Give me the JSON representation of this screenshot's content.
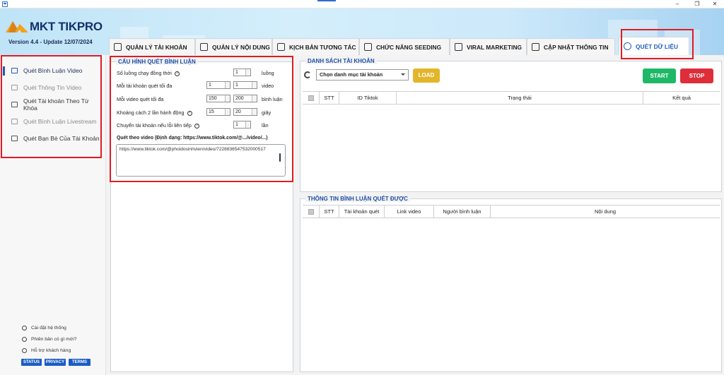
{
  "app": {
    "name": "MKT TIKPRO",
    "version": "Version  4.4  - Update  12/07/2024"
  },
  "window": {
    "minimize": "–",
    "restore": "❐",
    "close": "✕"
  },
  "tabs": [
    {
      "label": "QUẢN LÝ TÀI KHOẢN",
      "icon": "account-icon"
    },
    {
      "label": "QUẢN LÝ NỘI DUNG",
      "icon": "list-icon"
    },
    {
      "label": "KỊCH BẢN TƯƠNG TÁC",
      "icon": "hand-icon"
    },
    {
      "label": "CHỨC NĂNG SEEDING",
      "icon": "seeding-icon"
    },
    {
      "label": "VIRAL MARKETING",
      "icon": "viral-icon"
    },
    {
      "label": "CẬP NHẬT THÔNG TIN",
      "icon": "update-icon"
    },
    {
      "label": "QUÉT DỮ LIỆU",
      "icon": "scan-icon",
      "active": true
    }
  ],
  "sidebar": {
    "items": [
      {
        "label": "Quét Bình Luận Video",
        "icon": "comment-icon",
        "state": "active"
      },
      {
        "label": "Quét Thông Tin Video",
        "icon": "video-icon",
        "state": "muted"
      },
      {
        "label": "Quét Tài khoản Theo Từ Khóa",
        "icon": "keyword-icon",
        "state": "normal"
      },
      {
        "label": "Quét Bình Luận Livestream",
        "icon": "livestream-icon",
        "state": "muted"
      },
      {
        "label": "Quét Bạn Bè Của Tài Khoản",
        "icon": "friends-icon",
        "state": "normal"
      }
    ],
    "footer": {
      "settings": "Cài đặt hệ thống",
      "whats_new": "Phiên bản có gì mới?",
      "support": "Hỗ trợ khách hàng",
      "buttons": [
        "STATUS",
        "PRIVACY",
        "TERMS"
      ]
    }
  },
  "config": {
    "title": "CẤU HÌNH QUÉT BÌNH LUẬN",
    "threads_label": "Số luồng chạy đồng thời",
    "threads_value": "1",
    "threads_unit": "luồng",
    "max_accounts_label": "Mỗi tài khoản quét tối đa",
    "max_accounts_from": "1",
    "max_accounts_to": "1",
    "max_accounts_unit": "video",
    "max_comments_label": "Mỗi video quét tối đa",
    "max_comments_from": "150",
    "max_comments_to": "200",
    "max_comments_unit": "bình luận",
    "delay_label": "Khoảng cách 2 lần hành động",
    "delay_from": "15",
    "delay_to": "20",
    "delay_unit": "giây",
    "switch_label": "Chuyển tài khoản nếu lỗi liên tiếp",
    "switch_value": "1",
    "switch_unit": "lần",
    "video_label": "Quét theo video (Định dạng: https://www.tiktok.com/@.../video/...)",
    "video_value": "https://www.tiktok.com/@phoidosinhvien/video/7228836547532000517"
  },
  "accounts": {
    "title": "DANH SÁCH TÀI KHOẢN",
    "category_select": "Chọn danh mục tài khoản",
    "load": "LOAD",
    "start": "START",
    "stop": "STOP",
    "columns": [
      "STT",
      "ID Tiktok",
      "Trạng thái",
      "Kết quả"
    ]
  },
  "comments": {
    "title": "THÔNG TIN BÌNH LUẬN QUÉT ĐƯỢC",
    "columns": [
      "STT",
      "Tài khoản quét",
      "Link video",
      "Người bình luận",
      "Nội dung"
    ]
  },
  "colors": {
    "accent": "#1f5fbf",
    "start": "#1fb866",
    "stop": "#de2e3a",
    "load": "#e3b52b",
    "highlight": "#e01b24"
  }
}
